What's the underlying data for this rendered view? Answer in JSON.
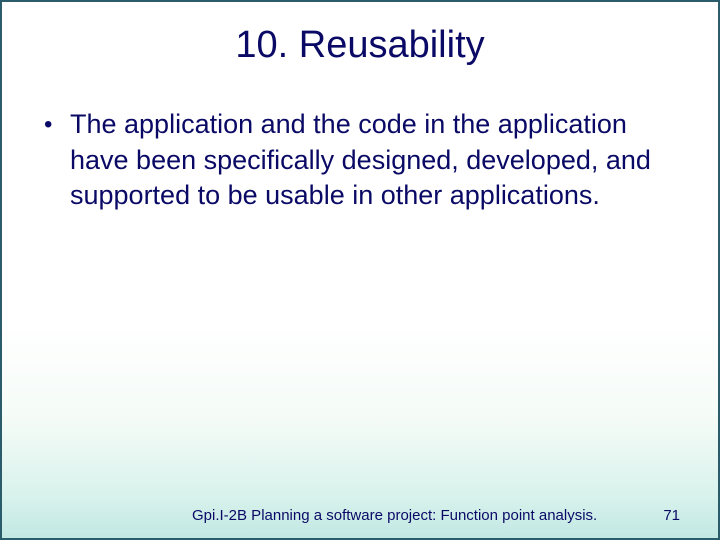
{
  "slide": {
    "title": "10. Reusability",
    "bullets": [
      "The application and the code in the application have been specifically designed, developed, and supported to be usable in other applications."
    ],
    "footer_text": "Gpi.I-2B Planning a software project: Function point analysis.",
    "page_number": "71"
  }
}
